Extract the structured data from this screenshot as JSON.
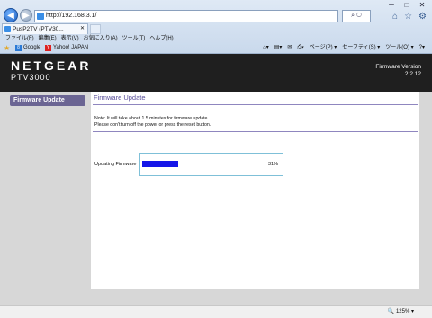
{
  "browser": {
    "url": "http://192.168.3.1/",
    "tab_title": "PusP2TV (PTV30...",
    "window_controls": {
      "minimize": "─",
      "maximize": "□",
      "close": "✕"
    },
    "menu": [
      "ファイル(F)",
      "編集(E)",
      "表示(V)",
      "お気に入り(A)",
      "ツール(T)",
      "ヘルプ(H)"
    ],
    "favorites": [
      {
        "label": "Google",
        "icon": "google-icon"
      },
      {
        "label": "Yahoo! JAPAN",
        "icon": "yahoo-icon"
      }
    ],
    "command_bar": [
      "ページ(P) ▾",
      "セーフティ(S) ▾",
      "ツール(O) ▾"
    ],
    "zoom": "125%"
  },
  "header": {
    "brand": "NETGEAR",
    "model": "PTV3000",
    "firmware_label": "Firmware Version",
    "firmware_value": "2.2.12"
  },
  "sidebar": {
    "item": "Firmware Update"
  },
  "main": {
    "title": "Firmware Update",
    "note_line1": "Note: It will take about 1.5 minutes for firmware update.",
    "note_line2": "Please don't turn off the power or press the reset button.",
    "progress_label": "Updating Firmware",
    "progress_value": 31,
    "progress_text": "31%"
  },
  "colors": {
    "progress_fill": "#1515e8",
    "sidebar_item": "#6b6593",
    "title_text": "#5a4f9a"
  }
}
